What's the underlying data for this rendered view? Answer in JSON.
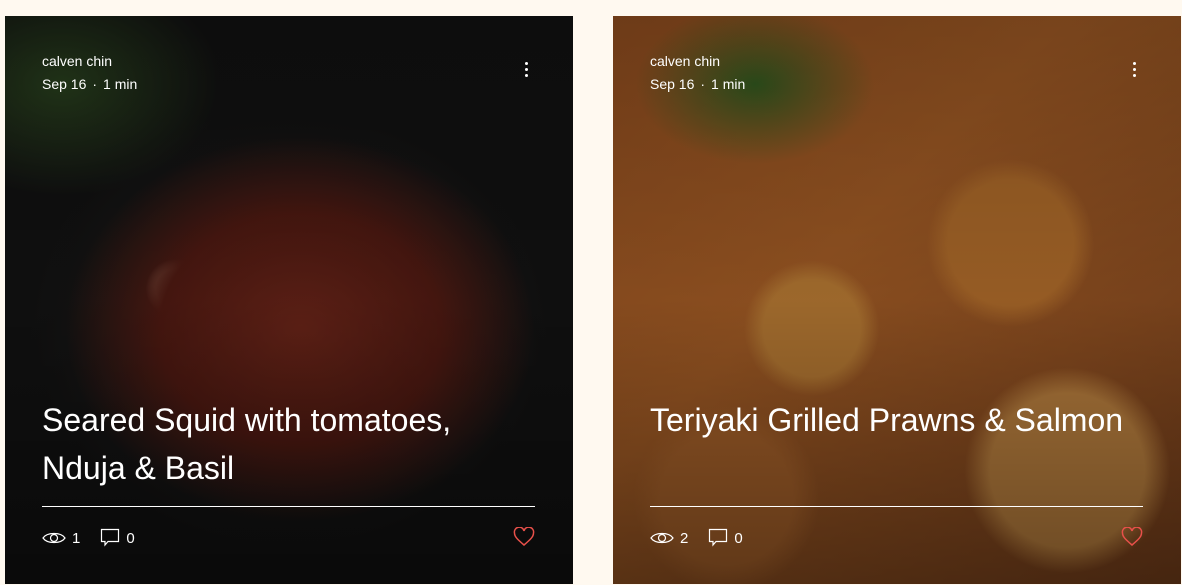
{
  "posts": [
    {
      "author": "calven chin",
      "date": "Sep 16",
      "read_time": "1 min",
      "title": "Seared Squid with tomatoes, Nduja & Basil",
      "views": "1",
      "comments": "0",
      "liked": false
    },
    {
      "author": "calven chin",
      "date": "Sep 16",
      "read_time": "1 min",
      "title": "Teriyaki Grilled Prawns & Salmon",
      "views": "2",
      "comments": "0",
      "liked": false
    }
  ],
  "colors": {
    "background": "#fff9f0",
    "heart": "#e8504a"
  }
}
